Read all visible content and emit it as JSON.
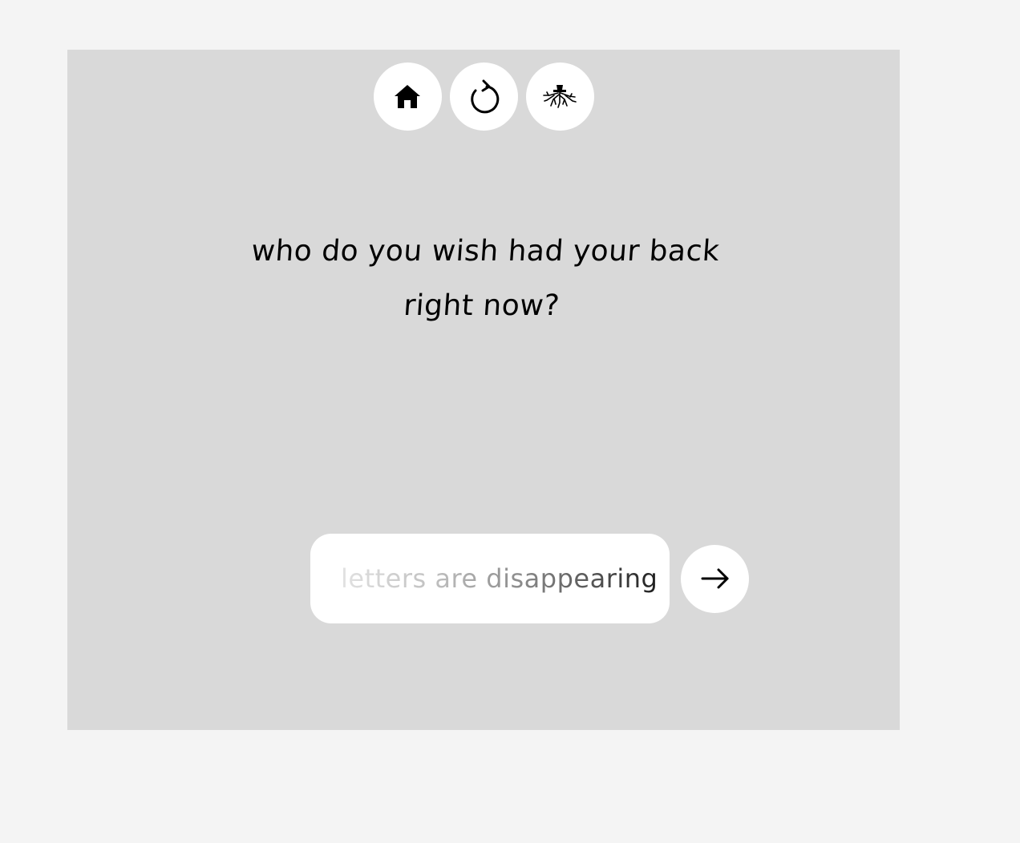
{
  "nav": {
    "buttons": [
      {
        "name": "home",
        "icon": "home-icon"
      },
      {
        "name": "refresh",
        "icon": "refresh-icon"
      },
      {
        "name": "roots",
        "icon": "roots-icon"
      }
    ]
  },
  "prompt": {
    "line1": "who do you wish had your back",
    "line2": "right now?"
  },
  "entry": {
    "placeholder": "letters are disappearing",
    "submit_icon": "arrow-right-icon"
  },
  "colors": {
    "page_background": "#f4f4f4",
    "panel_background": "#d9d9d9",
    "button_background": "#ffffff",
    "text": "#000000"
  }
}
